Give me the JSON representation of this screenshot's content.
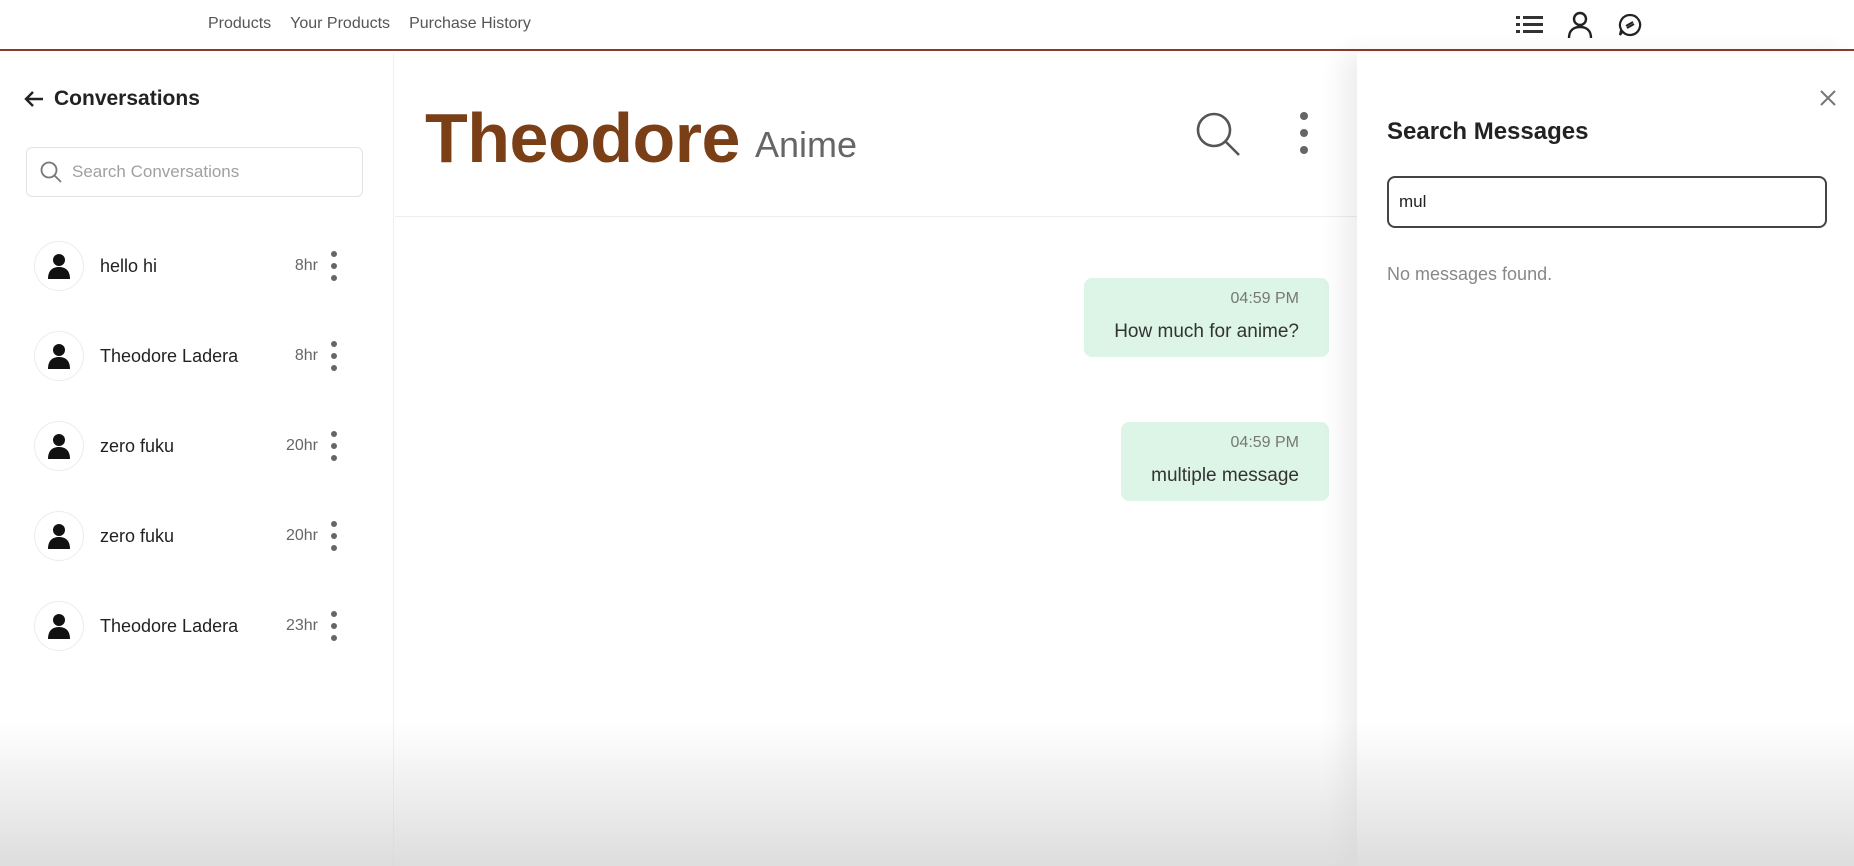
{
  "nav": {
    "products": "Products",
    "your_products": "Your Products",
    "purchase_history": "Purchase History"
  },
  "topbar_icons": [
    "list-icon",
    "user-icon",
    "chat-icon"
  ],
  "sidebar": {
    "title": "Conversations",
    "search_placeholder": "Search Conversations",
    "conversations": [
      {
        "name": "hello hi",
        "time": "8hr"
      },
      {
        "name": "Theodore Ladera",
        "time": "8hr"
      },
      {
        "name": "zero fuku",
        "time": "20hr"
      },
      {
        "name": "zero fuku",
        "time": "20hr"
      },
      {
        "name": "Theodore Ladera",
        "time": "23hr"
      }
    ]
  },
  "chat": {
    "name": "Theodore",
    "subtitle": "Anime",
    "messages": [
      {
        "time": "04:59 PM",
        "text": "How much for anime?"
      },
      {
        "time": "04:59 PM",
        "text": "multiple message"
      }
    ]
  },
  "search_panel": {
    "title": "Search Messages",
    "query": "mul",
    "empty_text": "No messages found."
  },
  "colors": {
    "accent": "#7a3f17",
    "topbar_border": "#8a3a2e",
    "bubble": "#dcf5e6"
  }
}
